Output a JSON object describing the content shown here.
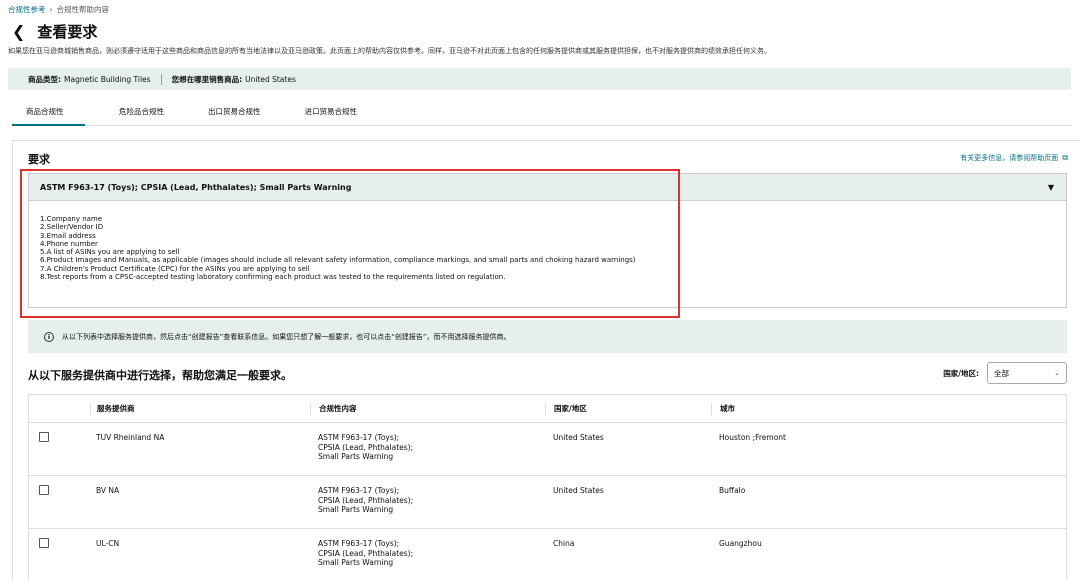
{
  "breadcrumb": {
    "items": [
      "合规性参考",
      "合规性帮助内容"
    ],
    "separator": "›"
  },
  "header": {
    "title": "查看要求",
    "back_icon": "chevron-left-icon"
  },
  "disclaimer": "如果您在亚马逊商城销售商品，则必须遵守适用于这些商品和商品信息的所有当地法律以及亚马逊政策。此页面上的帮助内容仅供参考。同样，亚马逊不对此页面上包含的任何服务提供商或其服务提供担保，也不对服务提供商的绩效承担任何义务。",
  "product_info": {
    "type_label": "商品类型:",
    "type_value": "Magnetic Building Tiles",
    "market_label": "您想在哪里销售商品:",
    "market_value": "United States"
  },
  "tabs": [
    {
      "label": "商品合规性",
      "active": true
    },
    {
      "label": "危险品合规性",
      "active": false
    },
    {
      "label": "出口贸易合规性",
      "active": false
    },
    {
      "label": "进口贸易合规性",
      "active": false
    }
  ],
  "requirements": {
    "heading": "要求",
    "help_link": "有关更多信息，请参阅帮助页面",
    "accordion_title": "ASTM F963-17 (Toys); CPSIA (Lead, Phthalates); Small Parts Warning",
    "items": [
      "1.Company name",
      "2.Seller/Vendor ID",
      "3.Email address",
      "4.Phone number",
      "5.A list of ASINs you are applying to sell",
      "6.Product Images and Manuals, as applicable (images should include all relevant safety information, compliance markings, and small parts and choking hazard warnings)",
      "7.A Children's Product Certificate (CPC) for the ASINs you are applying to sell",
      "8.Test reports from a CPSC-accepted testing laboratory confirming each product was tested to the requirements listed on regulation."
    ]
  },
  "info_banner": "从以下列表中选择服务提供商，然后点击“创建报告”查看联系信息。如果您只想了解一般要求，也可以点击“创建报告”，而不用选择服务提供商。",
  "providers_section": {
    "title": "从以下服务提供商中进行选择，帮助您满足一般要求。",
    "filter_label": "国家/地区:",
    "filter_value": "全部",
    "columns": [
      "服务提供商",
      "合规性内容",
      "国家/地区",
      "城市"
    ],
    "rows": [
      {
        "provider": "TUV Rheinland NA",
        "content": [
          "ASTM F963-17 (Toys);",
          "CPSIA (Lead, Phthalates);",
          "Small Parts Warning"
        ],
        "country": "United States",
        "city": "Houston ;Fremont"
      },
      {
        "provider": "BV NA",
        "content": [
          "ASTM F963-17 (Toys);",
          "CPSIA (Lead, Phthalates);",
          "Small Parts Warning"
        ],
        "country": "United States",
        "city": "Buffalo"
      },
      {
        "provider": "UL-CN",
        "content": [
          "ASTM F963-17 (Toys);",
          "CPSIA (Lead, Phthalates);",
          "Small Parts Warning"
        ],
        "country": "China",
        "city": "Guangzhou"
      }
    ]
  },
  "colors": {
    "accent": "#007185",
    "highlight": "#e0302b",
    "banner_bg": "#e6eeee"
  }
}
